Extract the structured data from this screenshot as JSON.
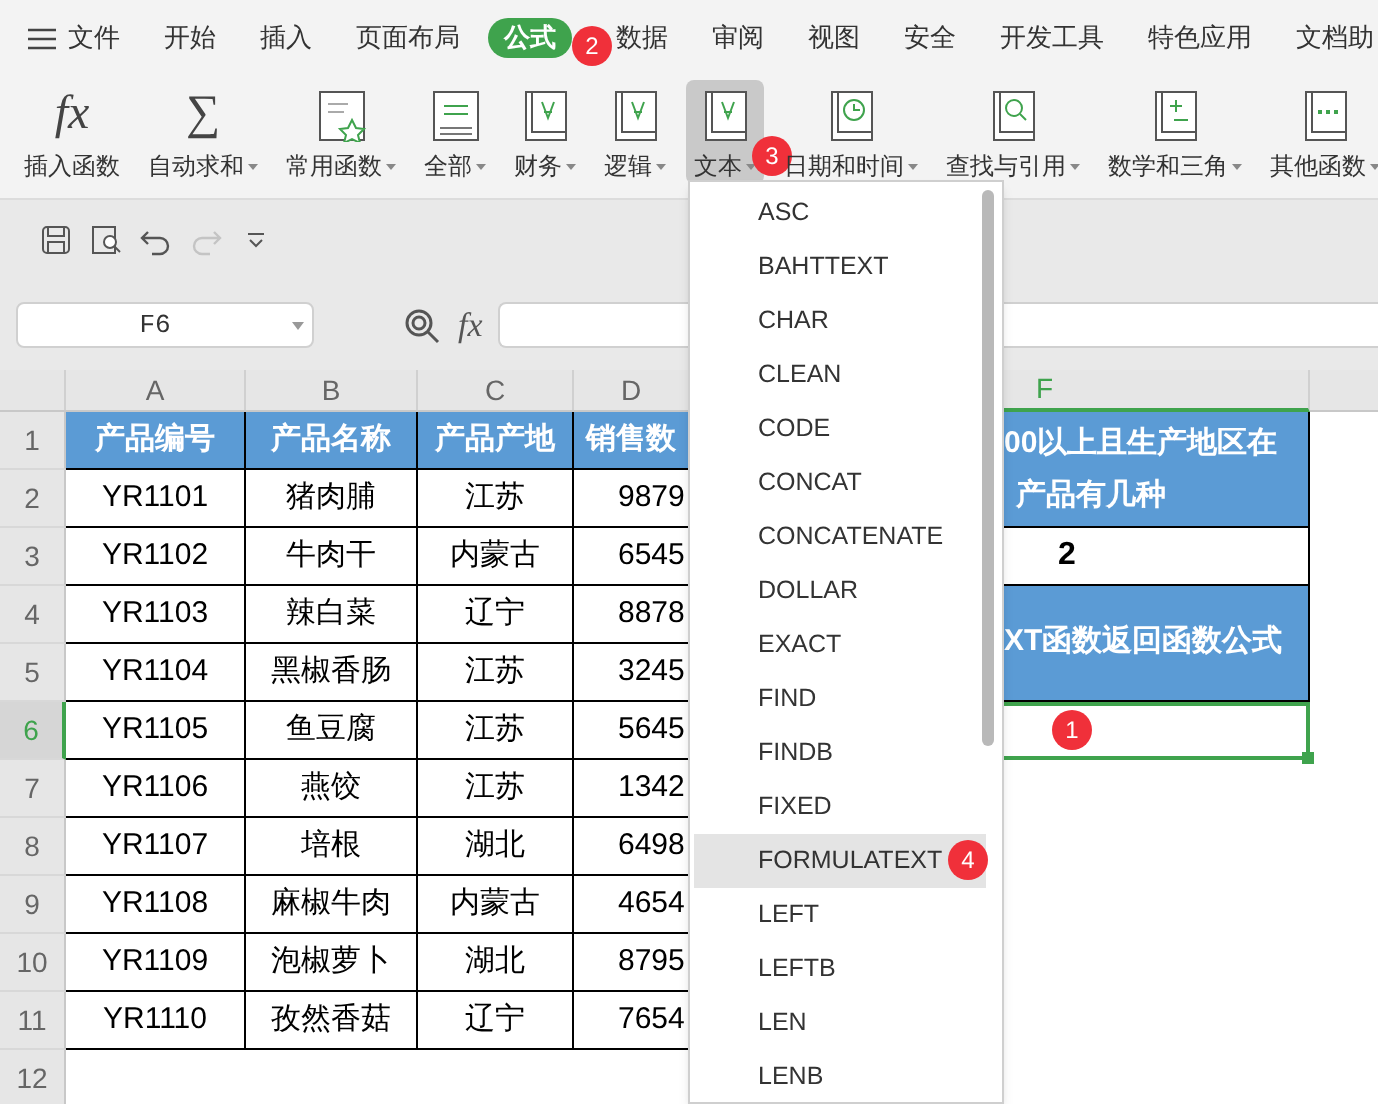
{
  "menu_tabs": [
    {
      "label": "文件",
      "kind": "file",
      "selected": false
    },
    {
      "label": "开始",
      "kind": "tab",
      "selected": false
    },
    {
      "label": "插入",
      "kind": "tab",
      "selected": false
    },
    {
      "label": "页面布局",
      "kind": "tab",
      "selected": false
    },
    {
      "label": "公式",
      "kind": "tab",
      "selected": true,
      "badge": "2"
    },
    {
      "label": "数据",
      "kind": "tab",
      "selected": false
    },
    {
      "label": "审阅",
      "kind": "tab",
      "selected": false
    },
    {
      "label": "视图",
      "kind": "tab",
      "selected": false
    },
    {
      "label": "安全",
      "kind": "tab",
      "selected": false
    },
    {
      "label": "开发工具",
      "kind": "tab",
      "selected": false
    },
    {
      "label": "特色应用",
      "kind": "tab",
      "selected": false
    },
    {
      "label": "文档助",
      "kind": "tab",
      "selected": false
    }
  ],
  "ribbon": [
    {
      "label": "插入函数",
      "kind": "glyph",
      "glyph": "fx",
      "has_menu": false,
      "selected": false
    },
    {
      "label": "自动求和",
      "kind": "glyph",
      "glyph": "∑",
      "has_menu": true,
      "selected": false
    },
    {
      "label": "常用函数",
      "kind": "star",
      "has_menu": true,
      "selected": false
    },
    {
      "label": "全部",
      "kind": "lines",
      "has_menu": true,
      "selected": false
    },
    {
      "label": "财务",
      "kind": "book",
      "has_menu": true,
      "selected": false
    },
    {
      "label": "逻辑",
      "kind": "book",
      "has_menu": true,
      "selected": false
    },
    {
      "label": "文本",
      "kind": "book",
      "has_menu": true,
      "selected": true,
      "badge": "3"
    },
    {
      "label": "日期和时间",
      "kind": "clock",
      "has_menu": true,
      "selected": false
    },
    {
      "label": "查找与引用",
      "kind": "lookup",
      "has_menu": true,
      "selected": false
    },
    {
      "label": "数学和三角",
      "kind": "math",
      "has_menu": true,
      "selected": false
    },
    {
      "label": "其他函数",
      "kind": "dots",
      "has_menu": true,
      "selected": false
    }
  ],
  "quick_access": [
    {
      "kind": "save",
      "disabled": false
    },
    {
      "kind": "preview",
      "disabled": false
    },
    {
      "kind": "undo",
      "disabled": false
    },
    {
      "kind": "redo",
      "disabled": true
    },
    {
      "kind": "more",
      "disabled": false
    }
  ],
  "name_box": "F6",
  "formula_glyph": "fx",
  "columns": [
    {
      "label": "A",
      "selected": false
    },
    {
      "label": "B",
      "selected": false
    },
    {
      "label": "C",
      "selected": false
    },
    {
      "label": "D",
      "selected": false
    },
    {
      "label": "F",
      "selected": true
    }
  ],
  "row_numbers": [
    {
      "label": "1",
      "selected": false
    },
    {
      "label": "2",
      "selected": false
    },
    {
      "label": "3",
      "selected": false
    },
    {
      "label": "4",
      "selected": false
    },
    {
      "label": "5",
      "selected": false
    },
    {
      "label": "6",
      "selected": true
    },
    {
      "label": "7",
      "selected": false
    },
    {
      "label": "8",
      "selected": false
    },
    {
      "label": "9",
      "selected": false
    },
    {
      "label": "10",
      "selected": false
    },
    {
      "label": "11",
      "selected": false
    },
    {
      "label": "12",
      "selected": false
    }
  ],
  "table": {
    "headers": [
      "产品编号",
      "产品名称",
      "产品产地",
      "销售数"
    ],
    "rows": [
      [
        "YR1101",
        "猪肉脯",
        "江苏",
        "9879"
      ],
      [
        "YR1102",
        "牛肉干",
        "内蒙古",
        "6545"
      ],
      [
        "YR1103",
        "辣白菜",
        "辽宁",
        "8878"
      ],
      [
        "YR1104",
        "黑椒香肠",
        "江苏",
        "3245"
      ],
      [
        "YR1105",
        "鱼豆腐",
        "江苏",
        "5645"
      ],
      [
        "YR1106",
        "燕饺",
        "江苏",
        "1342"
      ],
      [
        "YR1107",
        "培根",
        "湖北",
        "6498"
      ],
      [
        "YR1108",
        "麻椒牛肉",
        "内蒙古",
        "4654"
      ],
      [
        "YR1109",
        "泡椒萝卜",
        "湖北",
        "8795"
      ],
      [
        "YR1110",
        "孜然香菇",
        "辽宁",
        "7654"
      ]
    ]
  },
  "column_f": {
    "question_lines": [
      "00以上且生产地区在",
      "产品有几种"
    ],
    "answer": "2",
    "formula_label": "XT函数返回函数公式",
    "active_cell_badge": "1"
  },
  "function_menu": {
    "items": [
      {
        "label": "ASC",
        "selected": false
      },
      {
        "label": "BAHTTEXT",
        "selected": false
      },
      {
        "label": "CHAR",
        "selected": false
      },
      {
        "label": "CLEAN",
        "selected": false
      },
      {
        "label": "CODE",
        "selected": false
      },
      {
        "label": "CONCAT",
        "selected": false
      },
      {
        "label": "CONCATENATE",
        "selected": false
      },
      {
        "label": "DOLLAR",
        "selected": false
      },
      {
        "label": "EXACT",
        "selected": false
      },
      {
        "label": "FIND",
        "selected": false
      },
      {
        "label": "FINDB",
        "selected": false
      },
      {
        "label": "FIXED",
        "selected": false
      },
      {
        "label": "FORMULATEXT",
        "selected": true,
        "badge": "4"
      },
      {
        "label": "LEFT",
        "selected": false
      },
      {
        "label": "LEFTB",
        "selected": false
      },
      {
        "label": "LEN",
        "selected": false
      },
      {
        "label": "LENB",
        "selected": false
      }
    ]
  }
}
